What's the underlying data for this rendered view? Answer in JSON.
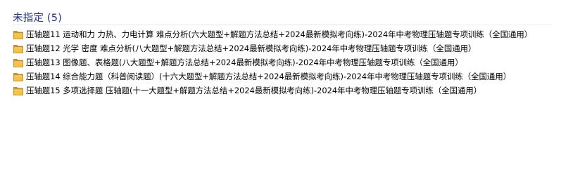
{
  "group": {
    "title": "未指定 (5)"
  },
  "items": [
    {
      "icon": "folder-icon",
      "name": "压轴题11 运动和力 力热、力电计算 难点分析(六大题型+解题方法总结+2024最新模拟考向练)-2024年中考物理压轴题专项训练（全国通用）"
    },
    {
      "icon": "folder-icon",
      "name": "压轴题12 光学 密度 难点分析(八大题型+解题方法总结+2024最新模拟考向练)-2024年中考物理压轴题专项训练（全国通用）"
    },
    {
      "icon": "folder-icon",
      "name": "压轴题13 图像题、表格题(八大题型+解题方法总结+2024最新模拟考向练)-2024年中考物理压轴题专项训练（全国通用）"
    },
    {
      "icon": "folder-icon",
      "name": "压轴题14 综合能力题（科普阅读题）(十六大题型+解题方法总结+2024最新模拟考向练)-2024年中考物理压轴题专项训练（全国通用）"
    },
    {
      "icon": "folder-icon",
      "name": "压轴题15 多项选择题 压轴题(十一大题型+解题方法总结+2024最新模拟考向练)-2024年中考物理压轴题专项训练（全国通用）"
    }
  ],
  "colors": {
    "group_title": "#1e3287",
    "folder_body": "#e8b33a",
    "folder_tab": "#d79a1f",
    "background": "#ffffff"
  }
}
